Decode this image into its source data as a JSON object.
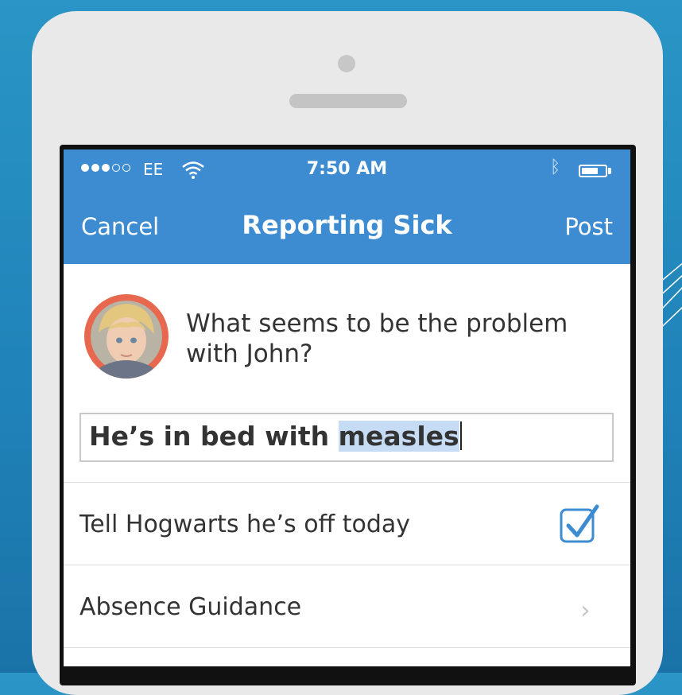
{
  "status_bar": {
    "carrier": "EE",
    "time": "7:50 AM",
    "signal_bars_filled": 3,
    "signal_bars_total": 5,
    "battery_level": 0.7,
    "icons": [
      "wifi-icon",
      "bluetooth-icon",
      "battery-icon"
    ]
  },
  "nav": {
    "cancel_label": "Cancel",
    "title": "Reporting Sick",
    "post_label": "Post"
  },
  "prompt": {
    "question": "What seems to be the problem with John?"
  },
  "reason_input": {
    "value_prefix": "He’s in bed with ",
    "value_selected": "measles"
  },
  "options": [
    {
      "label": "Tell Hogwarts he’s off today",
      "checked": true,
      "icon": "checkbox-checked-icon"
    },
    {
      "label": "Absence Guidance",
      "icon": "chevron-right-icon"
    }
  ],
  "colors": {
    "header": "#3d8cd2",
    "avatar_ring": "#e8674f",
    "accent": "#3d8cd2",
    "selection": "#c6dcf4"
  }
}
